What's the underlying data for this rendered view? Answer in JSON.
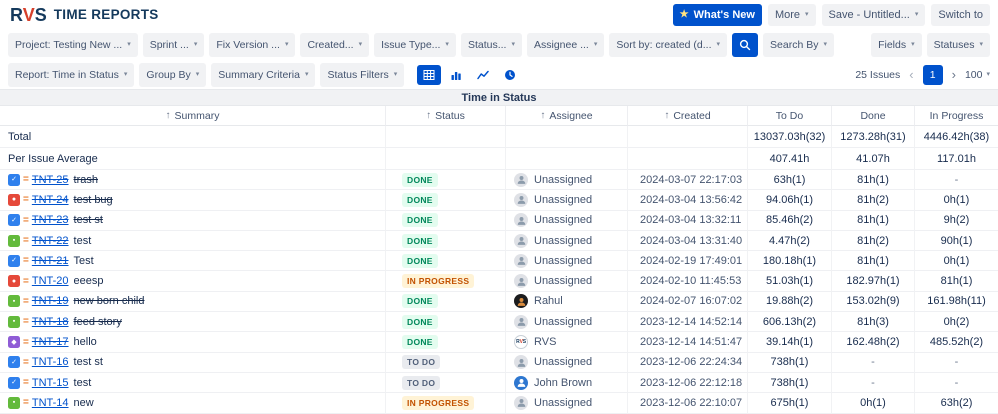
{
  "app": {
    "logo_r": "R",
    "logo_v": "V",
    "logo_s": "S",
    "title": "TIME REPORTS"
  },
  "topbar": {
    "whats_new": "What's New",
    "more": "More",
    "save": "Save - Untitled...",
    "switch_to": "Switch to"
  },
  "filters": {
    "project": "Project: Testing New ...",
    "sprint": "Sprint ...",
    "fix_version": "Fix Version ...",
    "created": "Created...",
    "issue_type": "Issue Type...",
    "status": "Status...",
    "assignee": "Assignee ...",
    "sort_by": "Sort by: created (d...",
    "search_by": "Search By",
    "fields": "Fields",
    "statuses": "Statuses"
  },
  "report_bar": {
    "report": "Report: Time in Status",
    "group_by": "Group By",
    "summary_criteria": "Summary Criteria",
    "status_filters": "Status Filters"
  },
  "pagination": {
    "issues_count": "25 Issues",
    "prev": "‹",
    "current_page": "1",
    "next": "›",
    "page_size": "100"
  },
  "icons": {
    "sparkle": "★",
    "chevron_down": "▾",
    "sort_asc": "↑",
    "priority_medium": "=",
    "type_glyphs": {
      "task": "✓",
      "bug": "●",
      "story": "▪",
      "epic": "◆"
    }
  },
  "colors": {
    "accent": "#0052CC",
    "link": "#0052CC",
    "done_text": "#00875A",
    "in_progress_text": "#C25100",
    "todo_text": "#505F79",
    "type_task": "#2F80ED",
    "type_bug": "#E5493A",
    "type_story": "#63BA3C",
    "type_epic": "#8F5CD6",
    "priority_medium": "#E97F33",
    "logo_navy": "#14395C",
    "logo_red": "#D6402B"
  },
  "table": {
    "title": "Time in Status",
    "columns": [
      "Summary",
      "Status",
      "Assignee",
      "Created",
      "To Do",
      "Done",
      "In Progress"
    ],
    "total_row": {
      "label": "Total",
      "todo": "13037.03h(32)",
      "done": "1273.28h(31)",
      "in_progress": "4446.42h(38)"
    },
    "average_row": {
      "label": "Per Issue Average",
      "todo": "407.41h",
      "done": "41.07h",
      "in_progress": "117.01h"
    },
    "rows": [
      {
        "key": "TNT-25",
        "summary": "trash",
        "type": "task",
        "priority": "Medium",
        "status": "DONE",
        "resolved": true,
        "summary_struck": true,
        "assignee": "Unassigned",
        "avatar": "unassigned",
        "created": "2024-03-07 22:17:03",
        "todo": "63h(1)",
        "done": "81h(1)",
        "in_progress": "-"
      },
      {
        "key": "TNT-24",
        "summary": "test bug",
        "type": "bug",
        "priority": "Medium",
        "status": "DONE",
        "resolved": true,
        "summary_struck": true,
        "assignee": "Unassigned",
        "avatar": "unassigned",
        "created": "2024-03-04 13:56:42",
        "todo": "94.06h(1)",
        "done": "81h(2)",
        "in_progress": "0h(1)"
      },
      {
        "key": "TNT-23",
        "summary": "test st",
        "type": "task",
        "priority": "Medium",
        "status": "DONE",
        "resolved": true,
        "summary_struck": true,
        "assignee": "Unassigned",
        "avatar": "unassigned",
        "created": "2024-03-04 13:32:11",
        "todo": "85.46h(2)",
        "done": "81h(1)",
        "in_progress": "9h(2)"
      },
      {
        "key": "TNT-22",
        "summary": "test",
        "type": "story",
        "priority": "Medium",
        "status": "DONE",
        "resolved": true,
        "summary_struck": false,
        "assignee": "Unassigned",
        "avatar": "unassigned",
        "created": "2024-03-04 13:31:40",
        "todo": "4.47h(2)",
        "done": "81h(2)",
        "in_progress": "90h(1)"
      },
      {
        "key": "TNT-21",
        "summary": "Test",
        "type": "task",
        "priority": "Medium",
        "status": "DONE",
        "resolved": true,
        "summary_struck": false,
        "assignee": "Unassigned",
        "avatar": "unassigned",
        "created": "2024-02-19 17:49:01",
        "todo": "180.18h(1)",
        "done": "81h(1)",
        "in_progress": "0h(1)"
      },
      {
        "key": "TNT-20",
        "summary": "eeesp",
        "type": "bug",
        "priority": "Medium",
        "status": "IN PROGRESS",
        "resolved": false,
        "summary_struck": false,
        "assignee": "Unassigned",
        "avatar": "unassigned",
        "created": "2024-02-10 11:45:53",
        "todo": "51.03h(1)",
        "done": "182.97h(1)",
        "in_progress": "81h(1)"
      },
      {
        "key": "TNT-19",
        "summary": "new born child",
        "type": "story",
        "priority": "Medium",
        "status": "DONE",
        "resolved": true,
        "summary_struck": true,
        "assignee": "Rahul",
        "avatar": "rahul",
        "created": "2024-02-07 16:07:02",
        "todo": "19.88h(2)",
        "done": "153.02h(9)",
        "in_progress": "161.98h(11)"
      },
      {
        "key": "TNT-18",
        "summary": "feed story",
        "type": "story",
        "priority": "Medium",
        "status": "DONE",
        "resolved": true,
        "summary_struck": true,
        "assignee": "Unassigned",
        "avatar": "unassigned",
        "created": "2023-12-14 14:52:14",
        "todo": "606.13h(2)",
        "done": "81h(3)",
        "in_progress": "0h(2)"
      },
      {
        "key": "TNT-17",
        "summary": "hello",
        "type": "epic",
        "priority": "Medium",
        "status": "DONE",
        "resolved": true,
        "summary_struck": false,
        "assignee": "RVS",
        "avatar": "rvs",
        "created": "2023-12-14 14:51:47",
        "todo": "39.14h(1)",
        "done": "162.48h(2)",
        "in_progress": "485.52h(2)"
      },
      {
        "key": "TNT-16",
        "summary": "test st",
        "type": "task",
        "priority": "Medium",
        "status": "TO DO",
        "resolved": false,
        "summary_struck": false,
        "assignee": "Unassigned",
        "avatar": "unassigned",
        "created": "2023-12-06 22:24:34",
        "todo": "738h(1)",
        "done": "-",
        "in_progress": "-"
      },
      {
        "key": "TNT-15",
        "summary": "test",
        "type": "task",
        "priority": "Medium",
        "status": "TO DO",
        "resolved": false,
        "summary_struck": false,
        "assignee": "John Brown",
        "avatar": "john",
        "created": "2023-12-06 22:12:18",
        "todo": "738h(1)",
        "done": "-",
        "in_progress": "-"
      },
      {
        "key": "TNT-14",
        "summary": "new",
        "type": "story",
        "priority": "Medium",
        "status": "IN PROGRESS",
        "resolved": false,
        "summary_struck": false,
        "assignee": "Unassigned",
        "avatar": "unassigned",
        "created": "2023-12-06 22:10:07",
        "todo": "675h(1)",
        "done": "0h(1)",
        "in_progress": "63h(2)"
      }
    ]
  }
}
